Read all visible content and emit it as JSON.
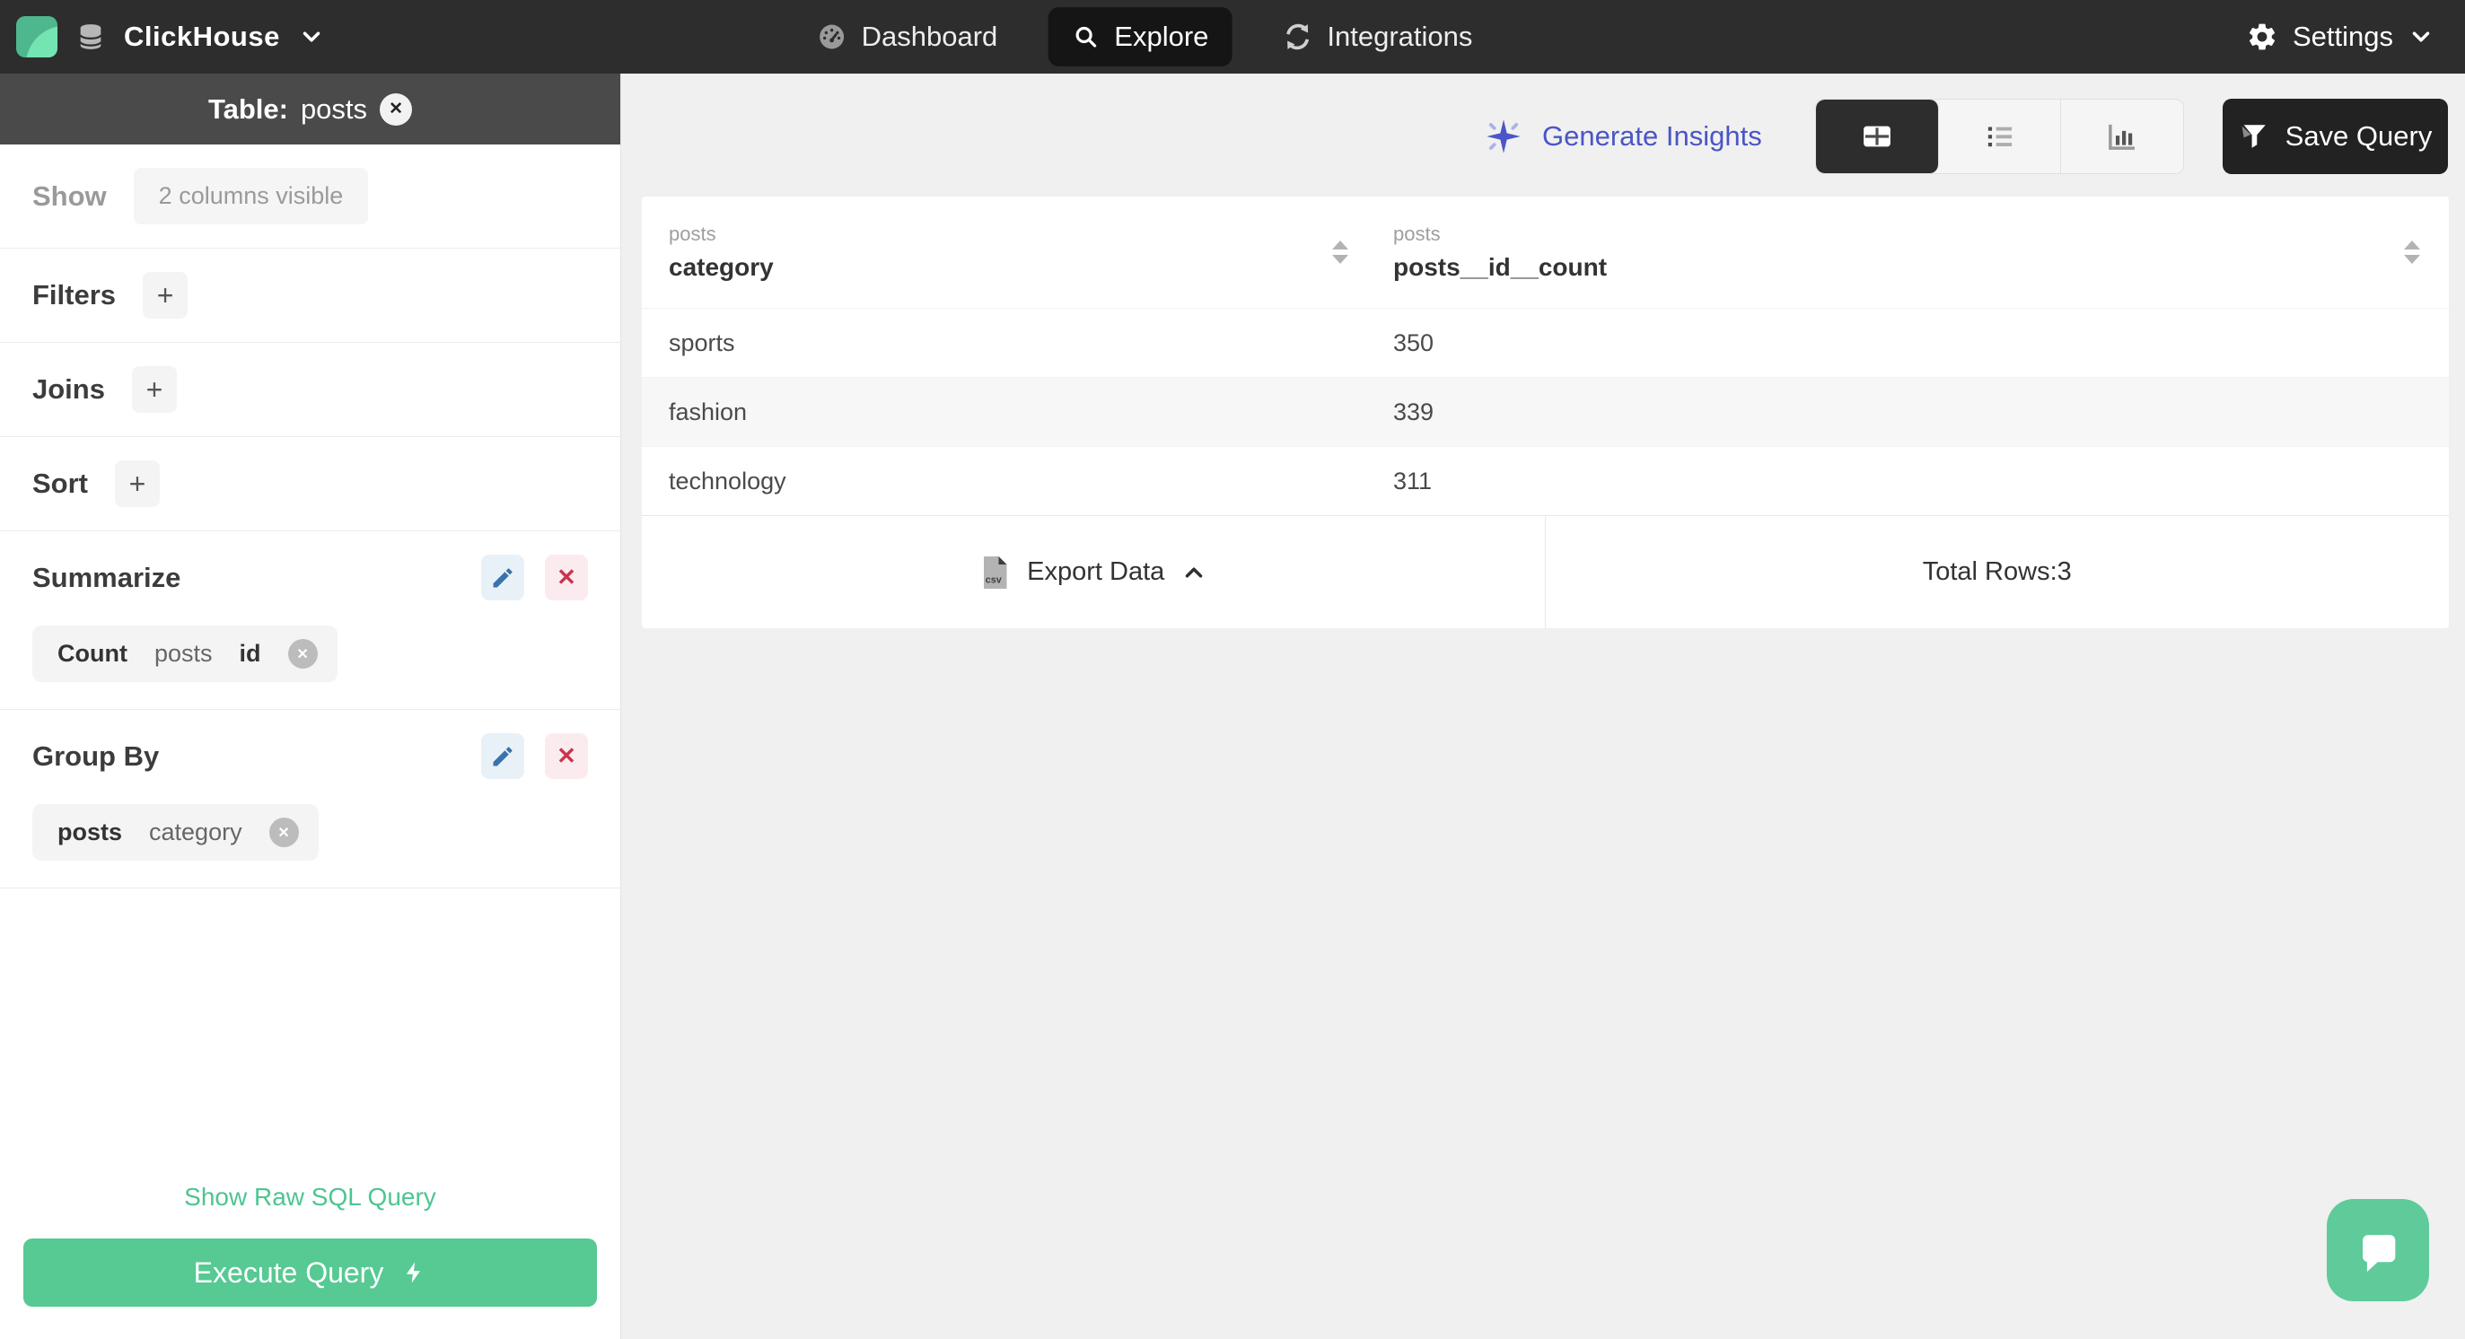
{
  "icons": {
    "plus": "+",
    "close": "✕",
    "csv_label": "csv"
  },
  "colors": {
    "nav_bg": "#2d2d2d",
    "active_tab_bg": "#151515",
    "sidebar_header_bg": "#4a4a4a",
    "accent_green": "#57c993",
    "link_green": "#4dc591",
    "chat_green": "#5fcb9a",
    "logo_green_dark": "#4fb78d",
    "logo_green_light": "#74e4b3",
    "accent_indigo": "#4a55c7",
    "edit_blue": "#3a72ad",
    "edit_bg": "#e9f1f8",
    "delete_red": "#c9344e",
    "delete_bg": "#fcebee",
    "page_bg": "#f0f0f0",
    "stripe": "#f7f7f7"
  },
  "nav": {
    "brand": "ClickHouse",
    "tabs": [
      {
        "label": "Dashboard"
      },
      {
        "label": "Explore"
      },
      {
        "label": "Integrations"
      }
    ],
    "settings": "Settings"
  },
  "sidebar": {
    "table_label": "Table:",
    "table_name": "posts",
    "show_label": "Show",
    "show_value": "2 columns visible",
    "filters_label": "Filters",
    "joins_label": "Joins",
    "sort_label": "Sort",
    "summarize_label": "Summarize",
    "summarize_chip": {
      "agg": "Count",
      "table": "posts",
      "column": "id"
    },
    "group_by_label": "Group By",
    "group_by_chip": {
      "table": "posts",
      "column": "category"
    },
    "raw_sql_link": "Show Raw SQL Query",
    "execute_button": "Execute Query"
  },
  "toolbar": {
    "generate_insights": "Generate Insights",
    "save_query": "Save Query"
  },
  "results": {
    "columns": [
      {
        "table": "posts",
        "name": "category"
      },
      {
        "table": "posts",
        "name": "posts__id__count"
      }
    ],
    "rows": [
      {
        "category": "sports",
        "count": "350"
      },
      {
        "category": "fashion",
        "count": "339"
      },
      {
        "category": "technology",
        "count": "311"
      }
    ],
    "export_label": "Export Data",
    "total_rows": "Total Rows:3"
  }
}
